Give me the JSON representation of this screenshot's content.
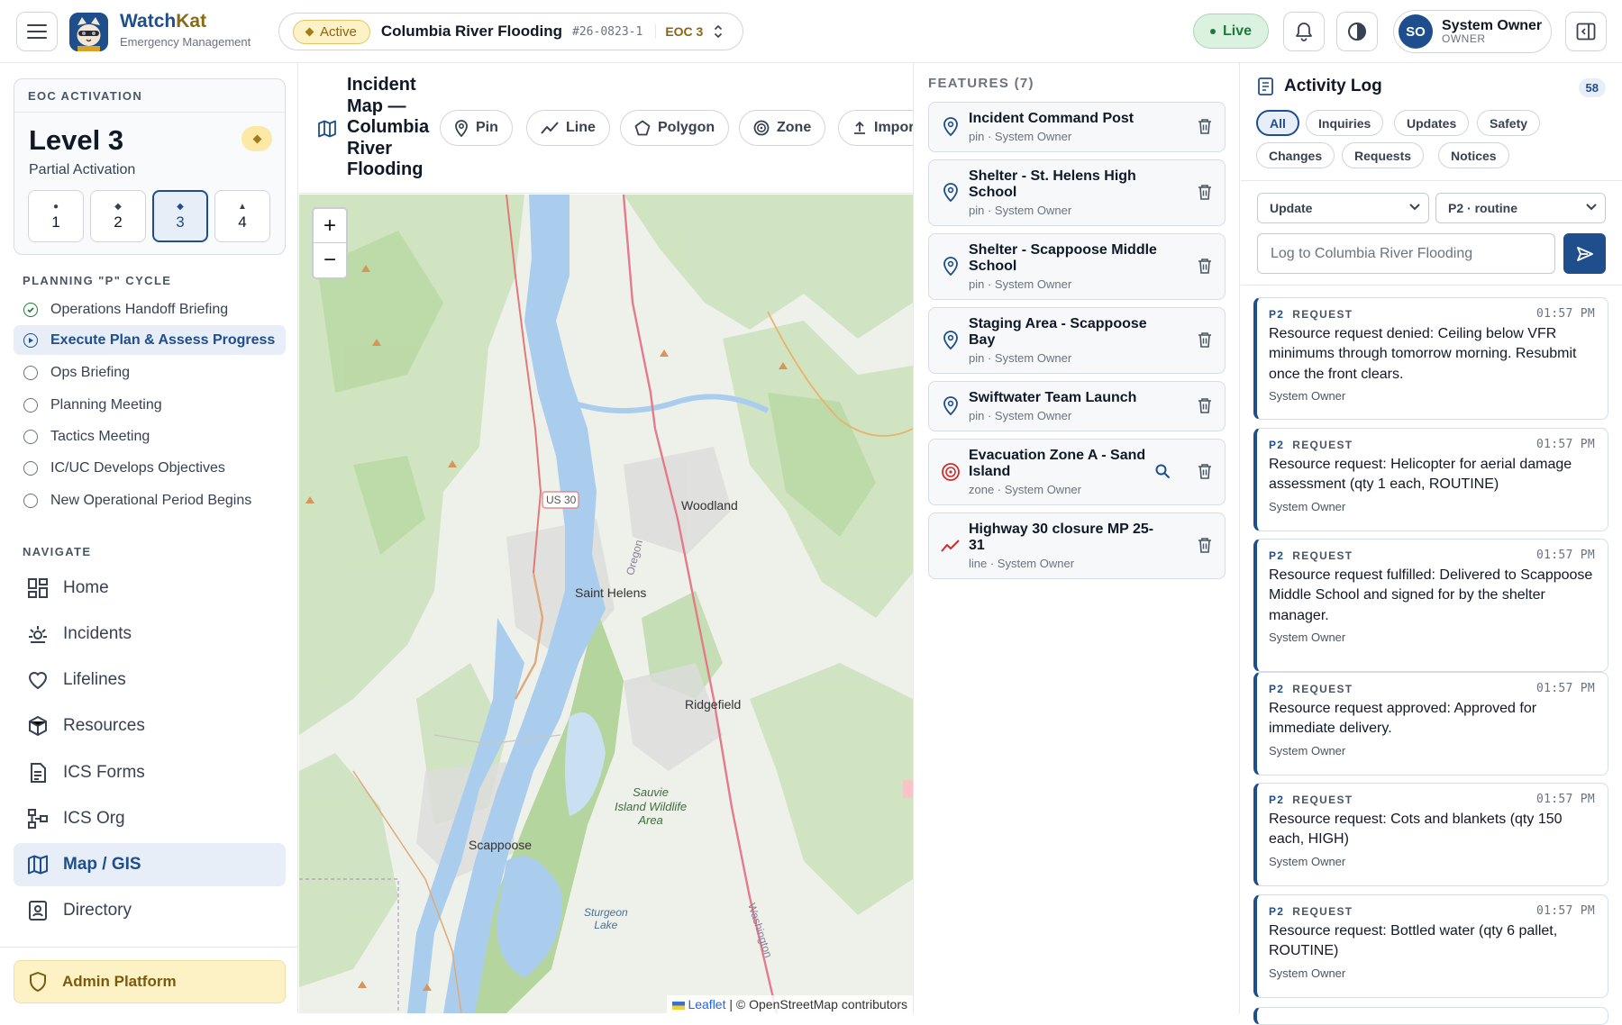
{
  "app": {
    "name_a": "Watch",
    "name_b": "Kat",
    "subtitle": "Emergency Management"
  },
  "incident": {
    "status": "Active",
    "name": "Columbia River Flooding",
    "id": "#26-0823-1",
    "eoc": "EOC 3"
  },
  "header": {
    "live": "Live",
    "user_initials": "SO",
    "user_name": "System Owner",
    "user_role": "OWNER"
  },
  "eoc": {
    "card_title": "EOC ACTIVATION",
    "level": "Level 3",
    "status": "Partial Activation",
    "levels": [
      {
        "label": "1"
      },
      {
        "label": "2"
      },
      {
        "label": "3"
      },
      {
        "label": "4"
      }
    ],
    "selected_level": "3"
  },
  "planning": {
    "title": "PLANNING \"P\" CYCLE",
    "steps": [
      {
        "label": "Operations Handoff Briefing",
        "state": "done"
      },
      {
        "label": "Execute Plan & Assess Progress",
        "state": "current"
      },
      {
        "label": "Ops Briefing",
        "state": "pending"
      },
      {
        "label": "Planning Meeting",
        "state": "pending"
      },
      {
        "label": "Tactics Meeting",
        "state": "pending"
      },
      {
        "label": "IC/UC Develops Objectives",
        "state": "pending"
      },
      {
        "label": "New Operational Period Begins",
        "state": "pending"
      }
    ]
  },
  "nav": {
    "title": "NAVIGATE",
    "items": [
      {
        "label": "Home",
        "icon": "dashboard-icon"
      },
      {
        "label": "Incidents",
        "icon": "incident-icon"
      },
      {
        "label": "Lifelines",
        "icon": "heart-icon"
      },
      {
        "label": "Resources",
        "icon": "package-icon"
      },
      {
        "label": "ICS Forms",
        "icon": "form-icon"
      },
      {
        "label": "ICS Org",
        "icon": "org-chart-icon"
      },
      {
        "label": "Map / GIS",
        "icon": "map-icon",
        "selected": true
      },
      {
        "label": "Directory",
        "icon": "directory-icon"
      }
    ],
    "admin": "Admin Platform"
  },
  "map": {
    "title": "Incident Map — Columbia River Flooding",
    "tools": [
      "Pin",
      "Line",
      "Polygon",
      "Zone",
      "Import"
    ],
    "labels": [
      "Woodland",
      "Saint Helens",
      "Ridgefield",
      "Scappoose",
      "Sauvie",
      "Island Wildlife",
      "Area",
      "Sturgeon",
      "Lake",
      "US 30",
      "Oregon",
      "Washington"
    ],
    "attribution_leaflet": "Leaflet",
    "attribution_rest": " | © OpenStreetMap contributors"
  },
  "features": {
    "title": "FEATURES (7)",
    "items": [
      {
        "name": "Incident Command Post",
        "meta": "pin · System Owner",
        "type": "pin"
      },
      {
        "name": "Shelter - St. Helens High School",
        "meta": "pin · System Owner",
        "type": "pin"
      },
      {
        "name": "Shelter - Scappoose Middle School",
        "meta": "pin · System Owner",
        "type": "pin"
      },
      {
        "name": "Staging Area - Scappoose Bay",
        "meta": "pin · System Owner",
        "type": "pin"
      },
      {
        "name": "Swiftwater Team Launch",
        "meta": "pin · System Owner",
        "type": "pin"
      },
      {
        "name": "Evacuation Zone A - Sand Island",
        "meta": "zone · System Owner",
        "type": "zone"
      },
      {
        "name": "Highway 30 closure MP 25-31",
        "meta": "line · System Owner",
        "type": "line"
      }
    ]
  },
  "activity": {
    "title": "Activity Log",
    "count": "58",
    "filters": [
      "All",
      "Inquiries",
      "Updates",
      "Safety",
      "Changes",
      "Requests",
      "Notices"
    ],
    "selected_filter": "All",
    "type_select": "Update",
    "priority_select": "P2 · routine",
    "input_placeholder": "Log to Columbia River Flooding",
    "entries": [
      {
        "priority": "P2",
        "kind": "REQUEST",
        "time": "01:57 PM",
        "message": "Resource request denied: Ceiling below VFR minimums through tomorrow morning. Resubmit once the front clears.",
        "by": "System Owner"
      },
      {
        "priority": "P2",
        "kind": "REQUEST",
        "time": "01:57 PM",
        "message": "Resource request: Helicopter for aerial damage assessment (qty 1 each, ROUTINE)",
        "by": "System Owner"
      },
      {
        "priority": "P2",
        "kind": "REQUEST",
        "time": "01:57 PM",
        "message": "Resource request fulfilled: Delivered to Scappoose Middle School and signed for by the shelter manager.",
        "by": "System Owner"
      },
      {
        "priority": "P2",
        "kind": "REQUEST",
        "time": "01:57 PM",
        "message": "Resource request approved: Approved for immediate delivery.",
        "by": "System Owner"
      },
      {
        "priority": "P2",
        "kind": "REQUEST",
        "time": "01:57 PM",
        "message": "Resource request: Cots and blankets (qty 150 each, HIGH)",
        "by": "System Owner"
      },
      {
        "priority": "P2",
        "kind": "REQUEST",
        "time": "01:57 PM",
        "message": "Resource request: Bottled water (qty 6 pallet, ROUTINE)",
        "by": "System Owner"
      }
    ]
  },
  "colors": {
    "primary": "#1e4e8c",
    "accent": "#a37b1b",
    "live": "#1e7a3c",
    "water": "#aacdee"
  }
}
